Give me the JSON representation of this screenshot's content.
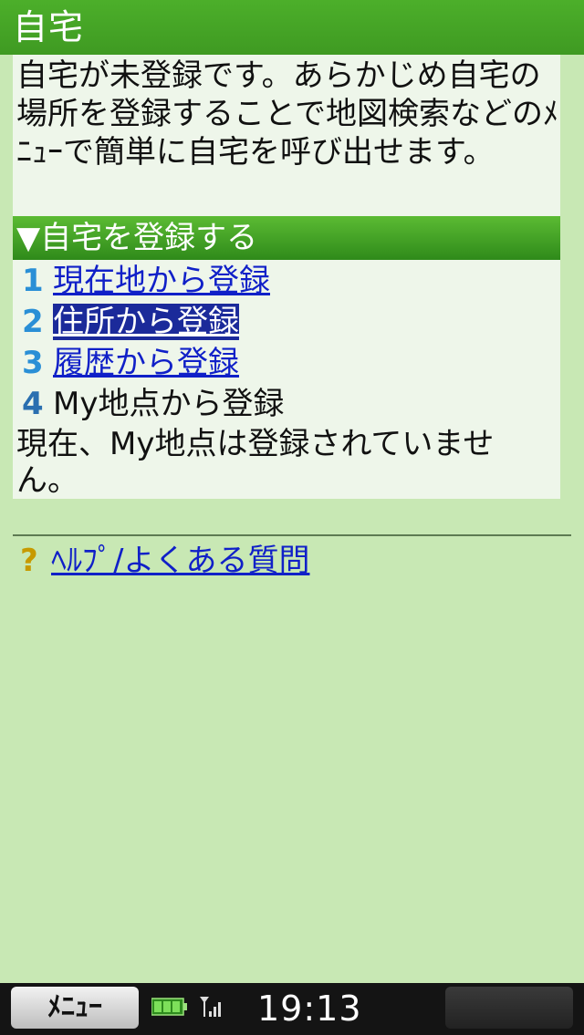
{
  "title": "自宅",
  "intro_text": "自宅が未登録です。あらかじめ自宅の場所を登録することで地図検索などのﾒﾆｭｰで簡単に自宅を呼び出せます。",
  "section_header": "▼自宅を登録する",
  "menu_items": [
    {
      "num": "1",
      "label": "現在地から登録",
      "link": true,
      "selected": false
    },
    {
      "num": "2",
      "label": "住所から登録",
      "link": true,
      "selected": true
    },
    {
      "num": "3",
      "label": "履歴から登録",
      "link": true,
      "selected": false
    },
    {
      "num": "4",
      "label": "My地点から登録",
      "link": false,
      "selected": false
    }
  ],
  "note_text": "現在、My地点は登録されていません。",
  "help": {
    "icon": "?",
    "label": "ﾍﾙﾌﾟ/よくある質問"
  },
  "status_bar": {
    "menu_label": "ﾒﾆｭｰ",
    "time": "19:13"
  },
  "colors": {
    "title_bar": "#4caf2a",
    "background": "#c8e8b4",
    "link": "#1020c8",
    "selected_bg": "#1b2a9a"
  }
}
